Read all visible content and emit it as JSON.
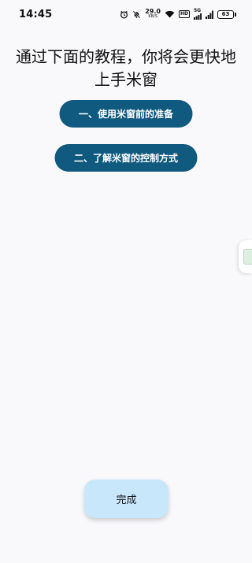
{
  "status_bar": {
    "time": "14:45",
    "net_speed_value": "29.0",
    "net_speed_unit": "KB/S",
    "hd_label": "HD",
    "net_type": "5G",
    "battery_level": "63",
    "icons": [
      "alarm-icon",
      "mute-icon",
      "wifi-icon",
      "hd-icon",
      "signal-icon",
      "signal-icon",
      "battery-icon"
    ]
  },
  "main": {
    "title": "通过下面的教程，你将会更快地上手米窗",
    "tutorials": [
      {
        "label": "一、使用米窗前的准备"
      },
      {
        "label": "二、了解米窗的控制方式"
      }
    ],
    "done_label": "完成"
  },
  "colors": {
    "background": "#f9f9fc",
    "primary_button": "#0f5a7e",
    "done_button": "#c9e7fb"
  }
}
